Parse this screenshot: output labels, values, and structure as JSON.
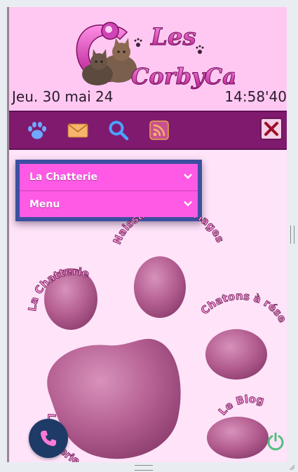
{
  "header": {
    "logo_text_top": "Les",
    "logo_text_bottom": "CorbyCats",
    "date": "Jeu. 30 mai 24",
    "time": "14:58'40"
  },
  "navbar": {
    "icons": [
      "paw-icon",
      "mail-icon",
      "search-icon",
      "rss-icon"
    ],
    "close_icon": "close-icon"
  },
  "menu": {
    "items": [
      {
        "label": "La Chatterie"
      },
      {
        "label": "Menu"
      }
    ]
  },
  "paw": {
    "toe_labels": [
      "La Chatterie",
      "Naissances Mariages",
      "Chatons à réserver",
      "Le Blog",
      "La Gallerie"
    ]
  },
  "colors": {
    "header_bg": "#ffc8f2",
    "nav_bg": "#7f1a6f",
    "menu_bg": "#ff5ae6",
    "paw": "#b35d90"
  }
}
